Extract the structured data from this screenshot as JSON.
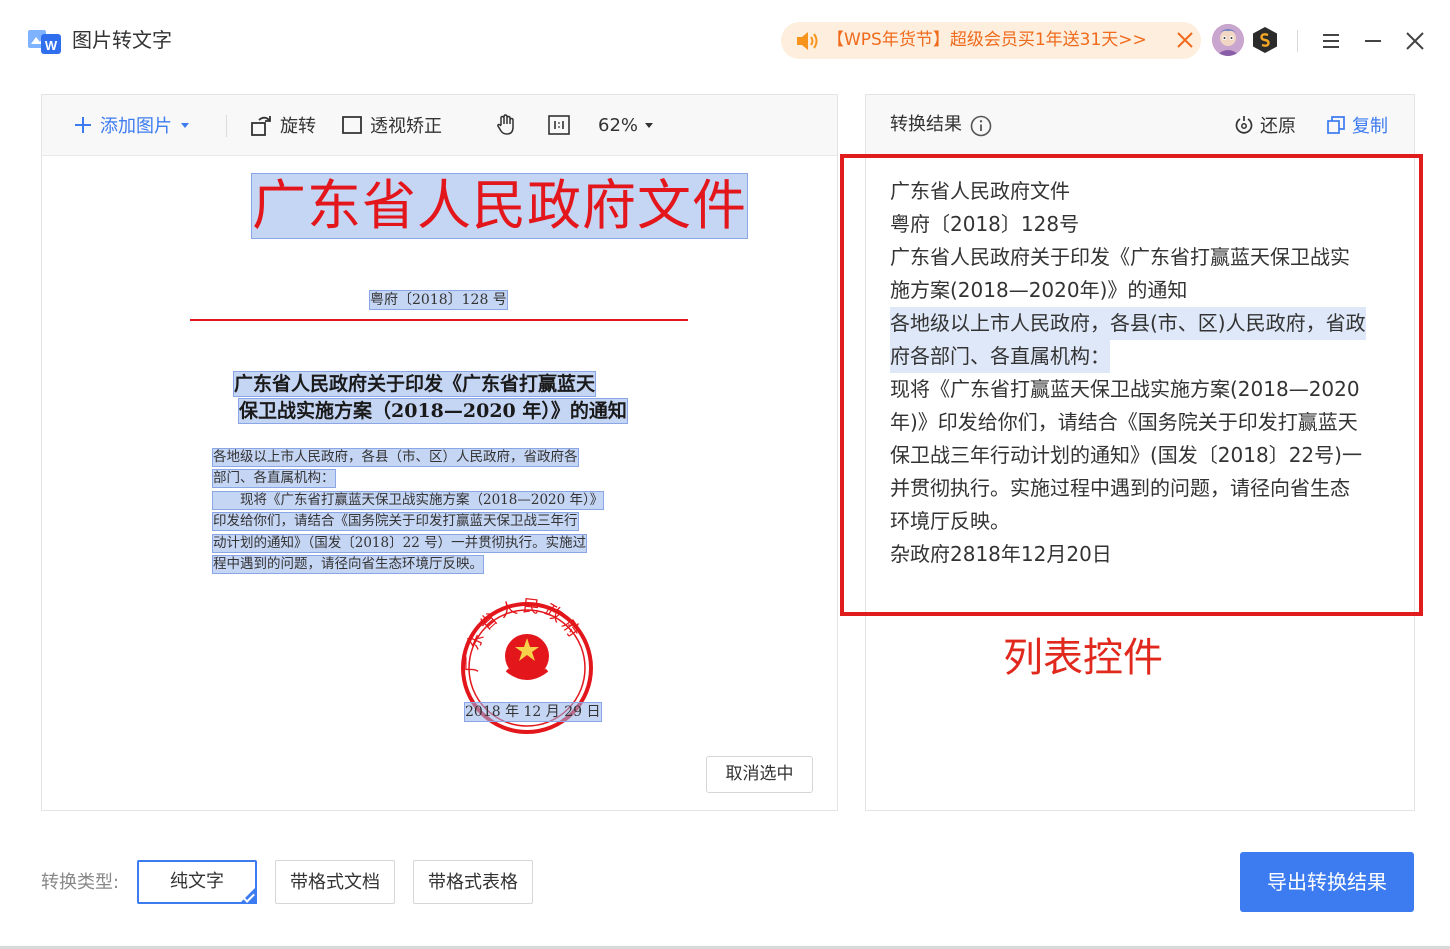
{
  "app": {
    "title": "图片转文字"
  },
  "promo": {
    "text": "【WPS年货节】超级会员买1年送31天>>"
  },
  "toolbar": {
    "add_image": "添加图片",
    "rotate": "旋转",
    "perspective": "透视矫正",
    "zoom": "62%"
  },
  "document": {
    "title": "广东省人民政府文件",
    "number": "粤府〔2018〕128 号",
    "heading_line1": "广东省人民政府关于印发《广东省打赢蓝天",
    "heading_line2": "保卫战实施方案（2018—2020 年）》的通知",
    "lines": [
      "各地级以上市人民政府，各县（市、区）人民政府，省政府各",
      "部门、各直属机构：",
      "　　现将《广东省打赢蓝天保卫战实施方案（2018—2020 年）》",
      "印发给你们，请结合《国务院关于印发打赢蓝天保卫战三年行",
      "动计划的通知》（国发〔2018〕22 号）一并贯彻执行。实施过",
      "程中遇到的问题，请径向省生态环境厅反映。"
    ],
    "seal_text": "广东省人民政府",
    "date": "2018 年 12 月 29 日",
    "deselect": "取消选中"
  },
  "result": {
    "title": "转换结果",
    "restore": "还原",
    "copy": "复制",
    "lines": [
      "广东省人民政府文件",
      "粤府〔2018〕128号",
      "广东省人民政府关于印发《广东省打赢蓝天保卫战实",
      "施方案(2018—2020年)》的通知",
      "各地级以上市人民政府，各县(市、区)人民政府，省政",
      "府各部门、各直属机构：",
      "现将《广东省打赢蓝天保卫战实施方案(2018—2020",
      "年)》印发给你们，请结合《国务院关于印发打赢蓝天",
      "保卫战三年行动计划的通知》(国发〔2018〕22号)一",
      "并贯彻执行。实施过程中遇到的问题，请径向省生态",
      "环境厅反映。",
      "杂政府2818年12月20日"
    ],
    "selected_lines": [
      4,
      5
    ]
  },
  "annotation": {
    "label": "列表控件"
  },
  "conversion": {
    "label": "转换类型:",
    "options": [
      "纯文字",
      "带格式文档",
      "带格式表格"
    ],
    "selected": "纯文字",
    "export": "导出转换结果"
  },
  "colors": {
    "accent": "#3d7bf0",
    "promo": "#f06a1c",
    "seal": "#e3161b",
    "annotation": "#e01c1c"
  }
}
